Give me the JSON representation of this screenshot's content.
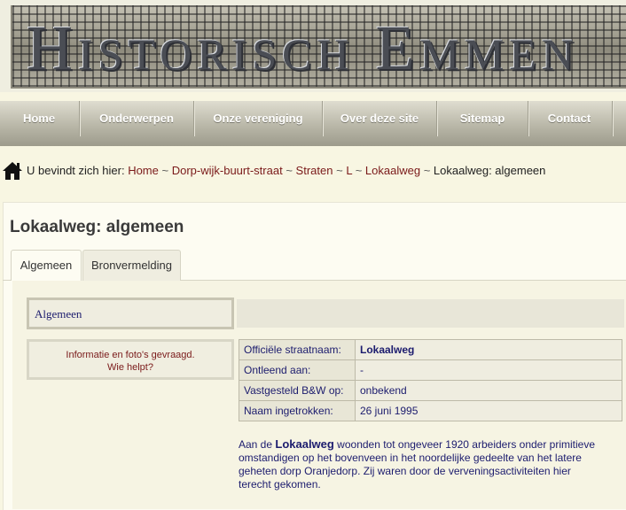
{
  "banner": {
    "title": "Historisch Emmen"
  },
  "nav": {
    "items": [
      {
        "label": "Home"
      },
      {
        "label": "Onderwerpen"
      },
      {
        "label": "Onze vereniging"
      },
      {
        "label": "Over deze site"
      },
      {
        "label": "Sitemap"
      },
      {
        "label": "Contact"
      }
    ]
  },
  "breadcrumb": {
    "prefix": "U bevindt zich hier:",
    "links": [
      "Home",
      "Dorp-wijk-buurt-straat",
      "Straten",
      "L",
      "Lokaalweg"
    ],
    "current": "Lokaalweg: algemeen",
    "separator": "~"
  },
  "page": {
    "title": "Lokaalweg: algemeen"
  },
  "tabs": [
    {
      "label": "Algemeen"
    },
    {
      "label": "Bronvermelding"
    }
  ],
  "section": {
    "label": "Algemeen"
  },
  "info": {
    "line1": "Informatie en foto's gevraagd.",
    "line2": "Wie helpt?"
  },
  "facts": [
    {
      "key": "Officiële straatnaam:",
      "value": "Lokaalweg"
    },
    {
      "key": "Ontleend aan:",
      "value": "-"
    },
    {
      "key": "Vastgesteld B&W op:",
      "value": "onbekend"
    },
    {
      "key": "Naam ingetrokken:",
      "value": "26 juni 1995"
    }
  ],
  "description": {
    "before": "Aan de ",
    "bold": "Lokaalweg",
    "after": " woonden tot ongeveer 1920 arbeiders onder primitieve omstandigen op het bovenveen in het noordelijke gedeelte van het latere geheten dorp Oranjedorp. Zij waren door de verveningsactiviteiten hier terecht gekomen."
  },
  "colors": {
    "link": "#7a1a1a",
    "table_text": "#1c1c6e",
    "nav_bg": "#b9b7a8"
  }
}
